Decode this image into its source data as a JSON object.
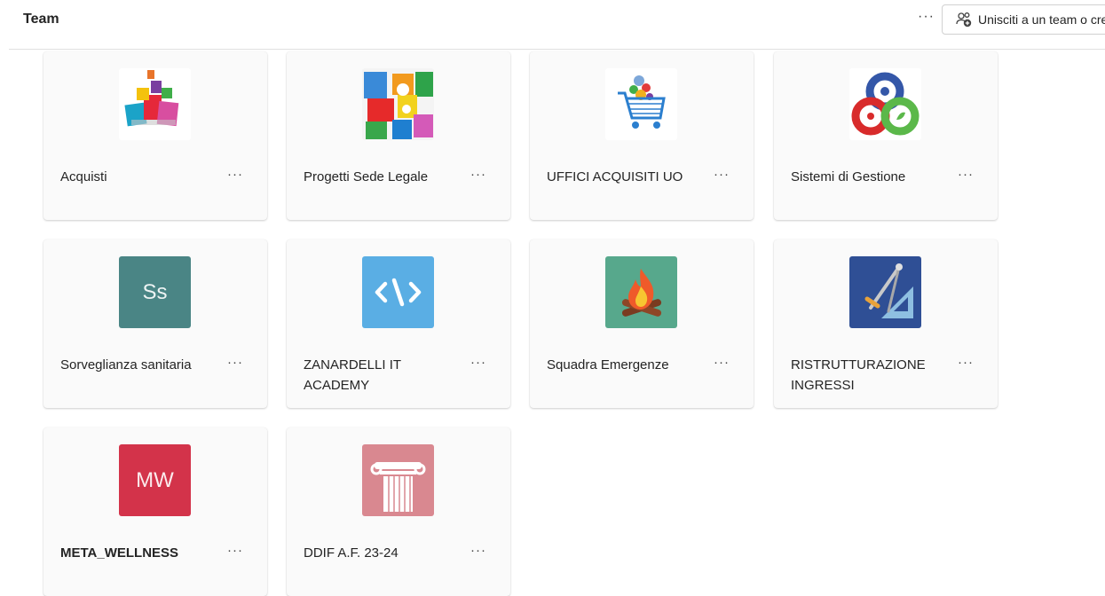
{
  "header": {
    "title": "Team",
    "more": "···",
    "join_label": "Unisciti a un team o creane uno"
  },
  "teams": [
    {
      "name": "Acquisti",
      "avatar": "shopping-bags-icon",
      "more": "···"
    },
    {
      "name": "Progetti Sede Legale",
      "avatar": "puzzle-pieces-icon",
      "more": "···"
    },
    {
      "name": "UFFICI ACQUISITI UO",
      "avatar": "shopping-cart-icon",
      "more": "···"
    },
    {
      "name": "Sistemi di Gestione",
      "avatar": "management-rings-icon",
      "more": "···"
    },
    {
      "name": "Sorveglianza sanitaria",
      "initials": "Ss",
      "color": "#4a8585",
      "more": "···"
    },
    {
      "name": "ZANARDELLI IT ACADEMY",
      "avatar": "code-icon",
      "color": "#5aaee4",
      "more": "···"
    },
    {
      "name": "Squadra Emergenze",
      "avatar": "campfire-icon",
      "color": "#57a88c",
      "more": "···"
    },
    {
      "name": "RISTRUTTURAZIONE INGRESSI",
      "avatar": "drafting-tools-icon",
      "color": "#2f4f95",
      "more": "···"
    },
    {
      "name": "META_WELLNESS",
      "initials": "MW",
      "color": "#d3334a",
      "more": "···"
    },
    {
      "name": "DDIF A.F. 23-24",
      "avatar": "column-icon",
      "color": "#d98890",
      "more": "···"
    }
  ]
}
